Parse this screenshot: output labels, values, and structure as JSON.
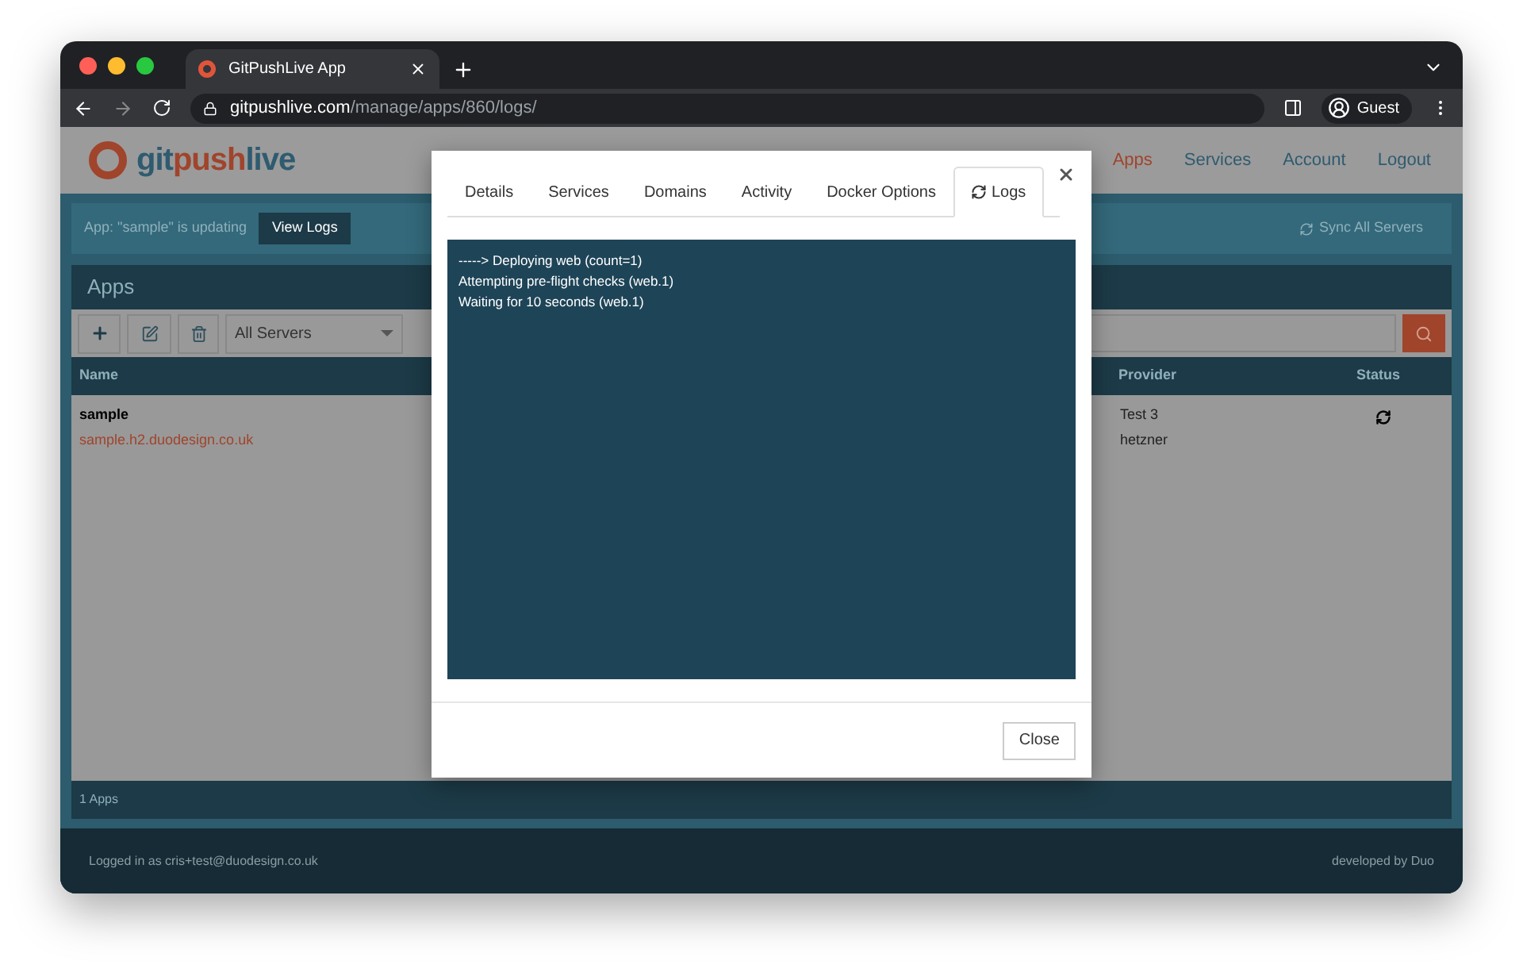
{
  "browser": {
    "tab_title": "GitPushLive App",
    "url_host": "gitpushlive.com",
    "url_path": "/manage/apps/860/logs/",
    "profile": "Guest"
  },
  "header": {
    "logo_parts": [
      {
        "text": "git",
        "accent": false
      },
      {
        "text": "push",
        "accent": true
      },
      {
        "text": "live",
        "accent": false
      }
    ],
    "nav": [
      {
        "label": "Apps",
        "selected": true
      },
      {
        "label": "Services",
        "selected": false
      },
      {
        "label": "Account",
        "selected": false
      },
      {
        "label": "Logout",
        "selected": false
      }
    ]
  },
  "banner": {
    "message": "App: \"sample\" is updating",
    "button": "View Logs",
    "sync_label": "Sync All Servers"
  },
  "panel": {
    "title": "Apps",
    "filter": "All Servers",
    "columns": [
      "Name",
      "Provider",
      "Status"
    ],
    "rows": [
      {
        "name": "sample",
        "domain": "sample.h2.duodesign.co.uk",
        "provider_name": "Test 3",
        "provider_type": "hetzner",
        "kind": "syncing"
      }
    ],
    "footer": "1 Apps"
  },
  "footer": {
    "left": "Logged in as cris+test@duodesign.co.uk",
    "right": "developed by Duo"
  },
  "modal": {
    "tabs": [
      {
        "label": "Details",
        "selected": false
      },
      {
        "label": "Services",
        "selected": false
      },
      {
        "label": "Domains",
        "selected": false
      },
      {
        "label": "Activity",
        "selected": false
      },
      {
        "label": "Docker Options",
        "selected": false
      },
      {
        "label": "Logs",
        "selected": true
      }
    ],
    "log_lines": [
      "-----> Deploying web (count=1)",
      "Attempting pre-flight checks (web.1)",
      "Waiting for 10 seconds (web.1)"
    ],
    "close_button": "Close"
  }
}
